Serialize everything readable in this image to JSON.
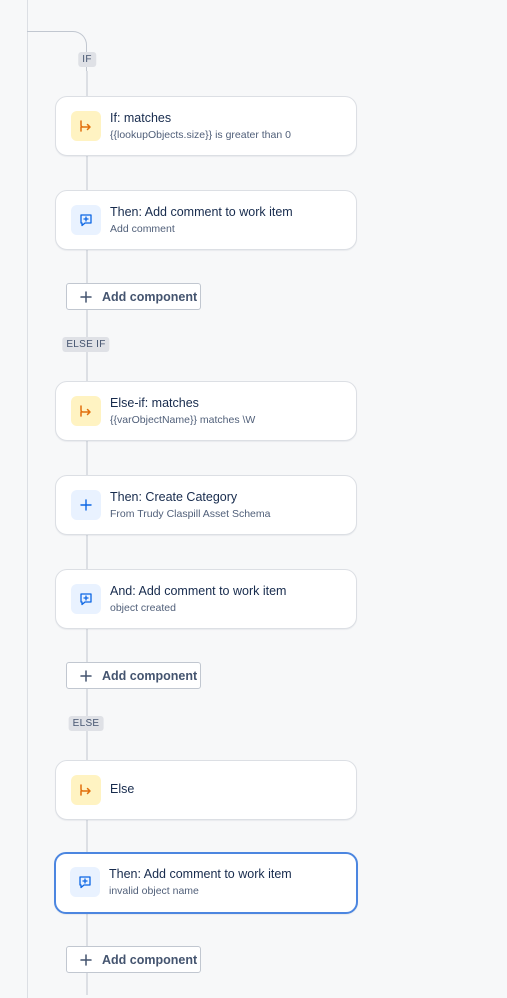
{
  "branches": {
    "if_label": "IF",
    "else_if_label": "ELSE IF",
    "else_label": "ELSE"
  },
  "cards": [
    {
      "title": "If: matches",
      "subtitle": "{{lookupObjects.size}} is greater than 0",
      "icon": "branch-icon"
    },
    {
      "title": "Then: Add comment to work item",
      "subtitle": "Add comment",
      "icon": "comment-add-icon"
    },
    {
      "title": "Else-if: matches",
      "subtitle": "{{varObjectName}} matches \\W",
      "icon": "branch-icon"
    },
    {
      "title": "Then: Create Category",
      "subtitle": "From Trudy Claspill Asset Schema",
      "icon": "plus-icon"
    },
    {
      "title": "And: Add comment to work item",
      "subtitle": "object created",
      "icon": "comment-add-icon"
    },
    {
      "title": "Else",
      "subtitle": "",
      "icon": "branch-icon"
    },
    {
      "title": "Then: Add comment to work item",
      "subtitle": "invalid object name",
      "icon": "comment-add-icon"
    }
  ],
  "add_component_label": "Add component",
  "colors": {
    "condition_icon_bg": "#fff3c2",
    "condition_icon": "#e2700c",
    "action_icon_bg": "#e9f2ff",
    "action_icon": "#0c66e4",
    "selected_border": "#4c86e0"
  }
}
